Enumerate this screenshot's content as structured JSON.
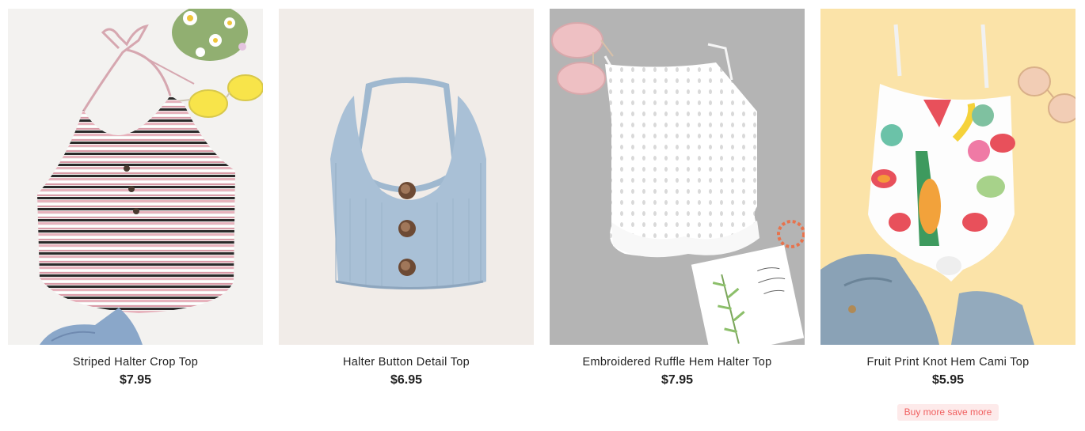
{
  "colors": {
    "promo_text": "#f06060",
    "promo_bg": "#fdeaea"
  },
  "products": [
    {
      "name": "Striped Halter Crop Top",
      "price": "$7.95",
      "image": "striped-halter-crop-top-image"
    },
    {
      "name": "Halter Button Detail Top",
      "price": "$6.95",
      "image": "halter-button-detail-top-image"
    },
    {
      "name": "Embroidered Ruffle Hem Halter Top",
      "price": "$7.95",
      "image": "embroidered-ruffle-hem-halter-top-image"
    },
    {
      "name": "Fruit Print Knot Hem Cami Top",
      "price": "$5.95",
      "image": "fruit-print-knot-hem-cami-top-image",
      "promo": "Buy more save more"
    }
  ]
}
